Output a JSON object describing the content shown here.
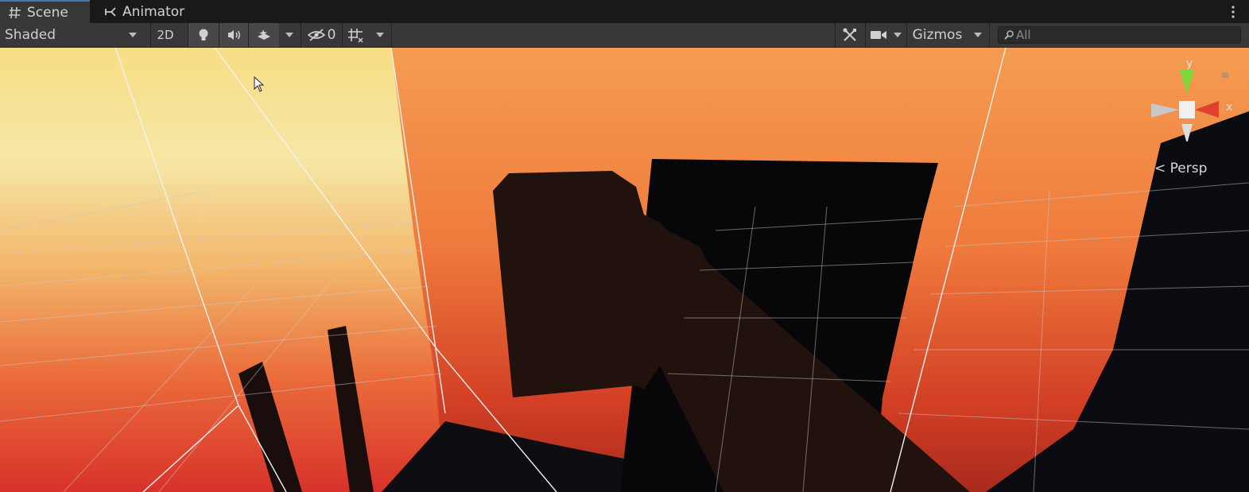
{
  "tabs": [
    {
      "label": "Scene",
      "icon": "grid-hash-icon",
      "active": true
    },
    {
      "label": "Animator",
      "icon": "animator-icon",
      "active": false
    }
  ],
  "toolbar": {
    "draw_mode": "Shaded",
    "toggle_2d": "2D",
    "hidden_count": "0",
    "gizmos_label": "Gizmos"
  },
  "search": {
    "placeholder": "All"
  },
  "gizmo": {
    "y_label": "y",
    "x_label": "x",
    "projection": "< Persp"
  },
  "colors": {
    "tab_accent": "#3a79bb",
    "toolbar_bg": "#383838",
    "axis_y": "#7dd63a",
    "axis_x": "#e0412d"
  }
}
